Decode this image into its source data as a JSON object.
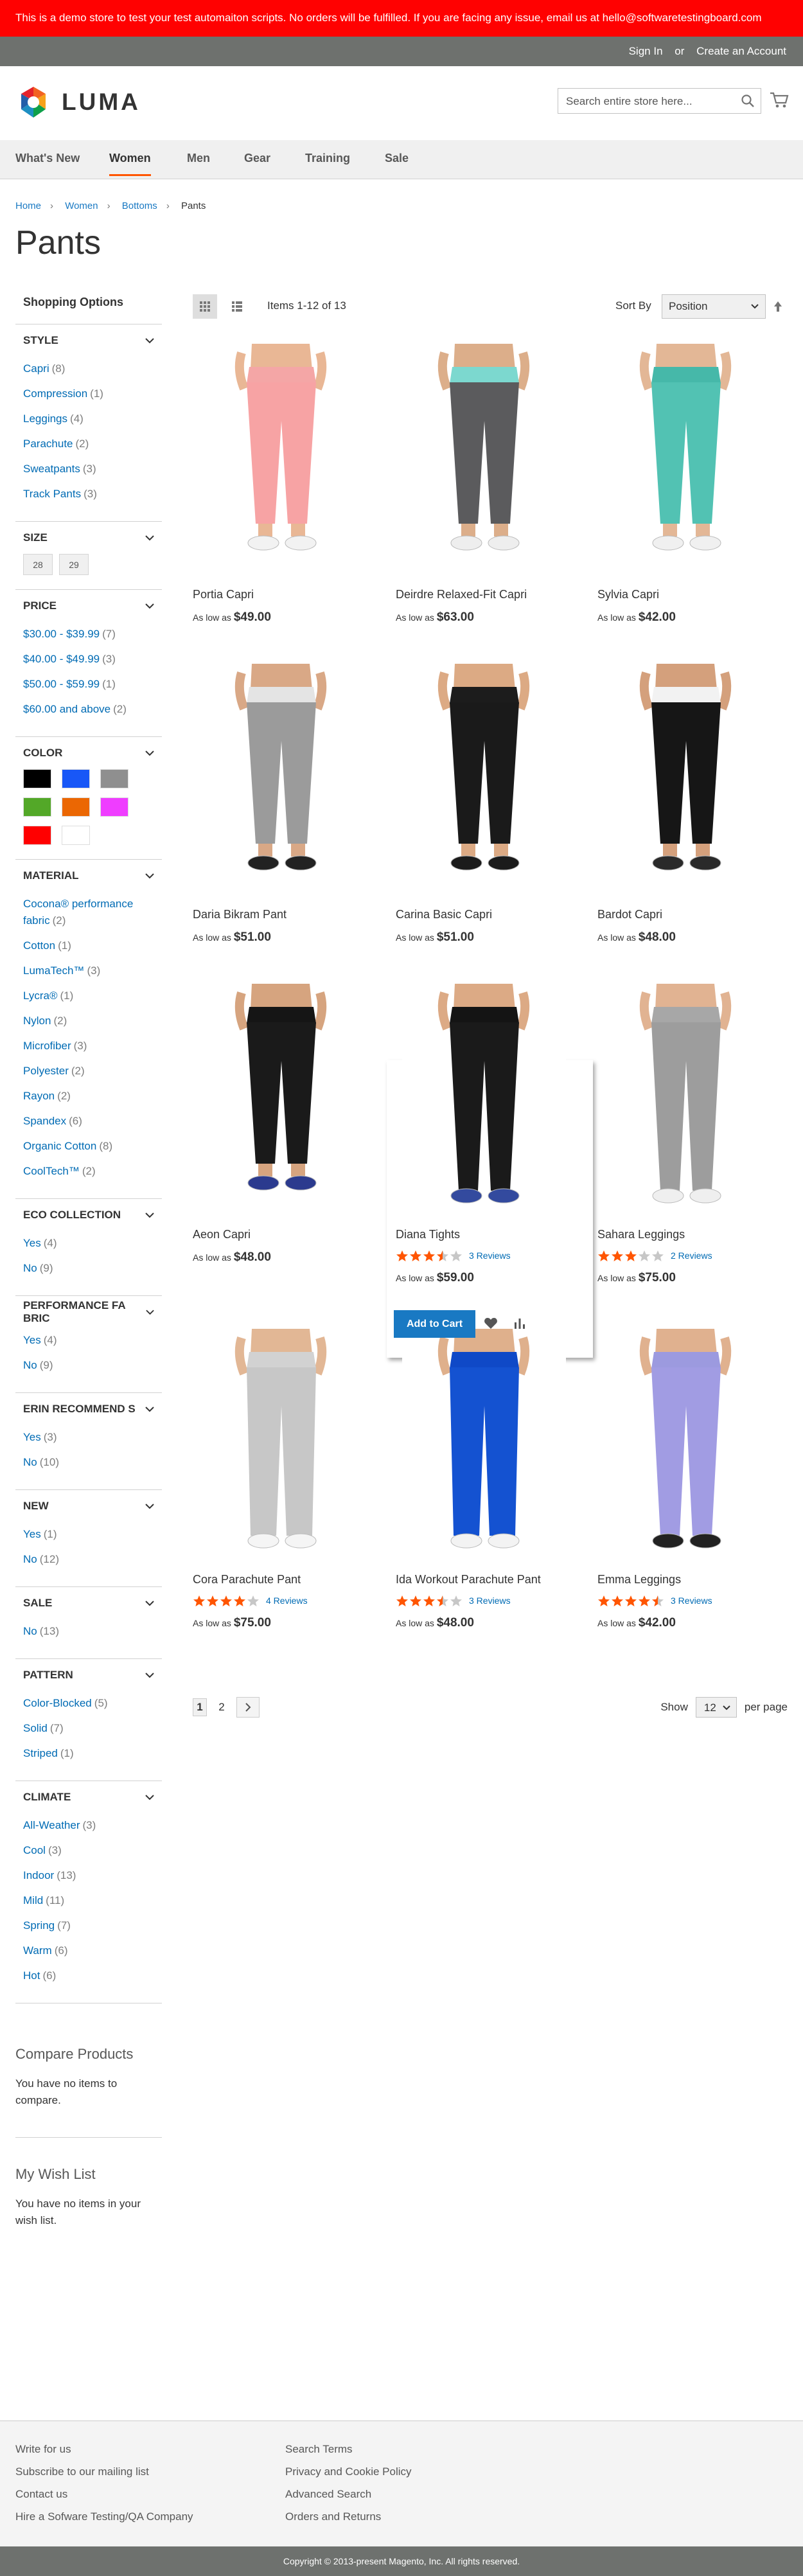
{
  "demo_notice": "This is a demo store to test your test automaiton scripts. No orders will be fulfilled. If you are facing any issue, email us at hello@softwaretestingboard.com",
  "header_links": {
    "sign_in": "Sign In",
    "or": "or",
    "create_account": "Create an Account"
  },
  "logo_text": "LUMA",
  "search": {
    "placeholder": "Search entire store here..."
  },
  "nav": [
    "What's New",
    "Women",
    "Men",
    "Gear",
    "Training",
    "Sale"
  ],
  "breadcrumbs": [
    "Home",
    "Women",
    "Bottoms",
    "Pants"
  ],
  "page_title": "Pants",
  "shopping_options_title": "Shopping Options",
  "filters": {
    "style": {
      "title": "Style",
      "options": [
        {
          "label": "Capri",
          "count": "8"
        },
        {
          "label": "Compression",
          "count": "1"
        },
        {
          "label": "Leggings",
          "count": "4"
        },
        {
          "label": "Parachute",
          "count": "2"
        },
        {
          "label": "Sweatpants",
          "count": "3"
        },
        {
          "label": "Track Pants",
          "count": "3"
        }
      ]
    },
    "size": {
      "title": "Size",
      "options": [
        "28",
        "29"
      ]
    },
    "price": {
      "title": "Price",
      "options": [
        {
          "label": "$30.00 - $39.99",
          "count": "7"
        },
        {
          "label": "$40.00 - $49.99",
          "count": "3"
        },
        {
          "label": "$50.00 - $59.99",
          "count": "1"
        },
        {
          "label": "$60.00 and above",
          "count": "2"
        }
      ]
    },
    "color": {
      "title": "Color",
      "swatches": [
        "#000000",
        "#1857f7",
        "#8f8f8f",
        "#53a828",
        "#eb6703",
        "#ef3dff",
        "#ff0000",
        "#ffffff"
      ]
    },
    "material": {
      "title": "Material",
      "options": [
        {
          "label": "Cocona® performance fabric",
          "count": "2"
        },
        {
          "label": "Cotton",
          "count": "1"
        },
        {
          "label": "LumaTech™",
          "count": "3"
        },
        {
          "label": "Lycra®",
          "count": "1"
        },
        {
          "label": "Nylon",
          "count": "2"
        },
        {
          "label": "Microfiber",
          "count": "3"
        },
        {
          "label": "Polyester",
          "count": "2"
        },
        {
          "label": "Rayon",
          "count": "2"
        },
        {
          "label": "Spandex",
          "count": "6"
        },
        {
          "label": "Organic Cotton",
          "count": "8"
        },
        {
          "label": "CoolTech™",
          "count": "2"
        }
      ]
    },
    "eco": {
      "title": "Eco Collection",
      "options": [
        {
          "label": "Yes",
          "count": "4"
        },
        {
          "label": "No",
          "count": "9"
        }
      ]
    },
    "performance": {
      "title": "Performance Fa bric",
      "options": [
        {
          "label": "Yes",
          "count": "4"
        },
        {
          "label": "No",
          "count": "9"
        }
      ]
    },
    "erin": {
      "title": "Erin Recommend s",
      "options": [
        {
          "label": "Yes",
          "count": "3"
        },
        {
          "label": "No",
          "count": "10"
        }
      ]
    },
    "new": {
      "title": "New",
      "options": [
        {
          "label": "Yes",
          "count": "1"
        },
        {
          "label": "No",
          "count": "12"
        }
      ]
    },
    "sale": {
      "title": "Sale",
      "options": [
        {
          "label": "No",
          "count": "13"
        }
      ]
    },
    "pattern": {
      "title": "Pattern",
      "options": [
        {
          "label": "Color-Blocked",
          "count": "5"
        },
        {
          "label": "Solid",
          "count": "7"
        },
        {
          "label": "Striped",
          "count": "1"
        }
      ]
    },
    "climate": {
      "title": "Climate",
      "options": [
        {
          "label": "All-Weather",
          "count": "3"
        },
        {
          "label": "Cool",
          "count": "3"
        },
        {
          "label": "Indoor",
          "count": "13"
        },
        {
          "label": "Mild",
          "count": "11"
        },
        {
          "label": "Spring",
          "count": "7"
        },
        {
          "label": "Warm",
          "count": "6"
        },
        {
          "label": "Hot",
          "count": "6"
        }
      ]
    }
  },
  "compare": {
    "title": "Compare Products",
    "text": "You have no items to compare."
  },
  "wishlist": {
    "title": "My Wish List",
    "text": "You have no items in your wish list."
  },
  "toolbar": {
    "amount": "Items 1-12 of 13",
    "sort_label": "Sort By",
    "sort_value": "Position"
  },
  "products": [
    {
      "name": "Portia Capri",
      "price_prefix": "As low as",
      "price": "$49.00",
      "colors": {
        "top": "#f4a6a6",
        "leg": "#f7a3a4",
        "skin": "#e9b795",
        "shoe": "#f2f2f2"
      }
    },
    {
      "name": "Deirdre Relaxed-Fit Capri",
      "price_prefix": "As low as",
      "price": "$63.00",
      "colors": {
        "top": "#7cd8cf",
        "leg": "#5b5b5d",
        "skin": "#dcae8a",
        "shoe": "#eeeeee"
      }
    },
    {
      "name": "Sylvia Capri",
      "price_prefix": "As low as",
      "price": "$42.00",
      "colors": {
        "top": "#46b8a9",
        "leg": "#52c2b3",
        "skin": "#e3b796",
        "shoe": "#f0f0f0"
      }
    },
    {
      "name": "Daria Bikram Pant",
      "price_prefix": "As low as",
      "price": "$51.00",
      "colors": {
        "top": "#e4e4e4",
        "leg": "#9b9b9b",
        "skin": "#d9a886",
        "shoe": "#222222"
      }
    },
    {
      "name": "Carina Basic Capri",
      "price_prefix": "As low as",
      "price": "$51.00",
      "colors": {
        "top": "#1c1c1c",
        "leg": "#1a1a1a",
        "skin": "#dcaa84",
        "shoe": "#1b1b1b"
      }
    },
    {
      "name": "Bardot Capri",
      "price_prefix": "As low as",
      "price": "$48.00",
      "colors": {
        "top": "#f2f2f2",
        "leg": "#161616",
        "skin": "#d4a07c",
        "shoe": "#2a2a2a"
      }
    },
    {
      "name": "Aeon Capri",
      "price_prefix": "As low as",
      "price": "$48.00",
      "colors": {
        "top": "#151515",
        "leg": "#1a1a1a",
        "skin": "#d6a47f",
        "shoe": "#2b3a8e"
      }
    },
    {
      "name": "Diana Tights",
      "price_prefix": "As low as",
      "price": "$59.00",
      "rating": 3.5,
      "reviews": "3 Reviews",
      "colors": {
        "top": "#141414",
        "leg": "#1a1a1a",
        "skin": "#dcaa85",
        "shoe": "#334a9e"
      }
    },
    {
      "name": "Sahara Leggings",
      "price_prefix": "As low as",
      "price": "$75.00",
      "rating": 3,
      "reviews": "2 Reviews",
      "colors": {
        "top": "#a7a7a7",
        "leg": "#9d9d9d",
        "skin": "#e1b392",
        "shoe": "#efefef"
      }
    },
    {
      "name": "Cora Parachute Pant",
      "price_prefix": "As low as",
      "price": "$75.00",
      "rating": 4,
      "reviews": "4 Reviews",
      "colors": {
        "top": "#d2d2d2",
        "leg": "#c7c7c7",
        "skin": "#e2b795",
        "shoe": "#f5f5f5"
      }
    },
    {
      "name": "Ida Workout Parachute Pant",
      "price_prefix": "As low as",
      "price": "$48.00",
      "rating": 3.5,
      "reviews": "3 Reviews",
      "colors": {
        "top": "#0f49c7",
        "leg": "#1452d1",
        "skin": "#dfb08c",
        "shoe": "#f3f3f3"
      }
    },
    {
      "name": "Emma Leggings",
      "price_prefix": "As low as",
      "price": "$42.00",
      "rating": 4.5,
      "reviews": "3 Reviews",
      "colors": {
        "top": "#9c9adf",
        "leg": "#a19ce3",
        "skin": "#e0b18f",
        "shoe": "#222222"
      }
    }
  ],
  "add_to_cart": "Add to Cart",
  "pager": {
    "pages": [
      "1",
      "2"
    ],
    "show_label": "Show",
    "limit": "12",
    "per_page": "per page"
  },
  "footer": {
    "col1": [
      "Write for us",
      "Subscribe to our mailing list",
      "Contact us",
      "Hire a Sofware Testing/QA Company"
    ],
    "col2": [
      "Search Terms",
      "Privacy and Cookie Policy",
      "Advanced Search",
      "Orders and Returns"
    ]
  },
  "copyright": "Copyright © 2013-present Magento, Inc. All rights reserved.",
  "colors": {
    "accent": "#1979c3",
    "star": "#ff5501",
    "demo_bar": "#ff0101",
    "footer_bar": "#6e716e"
  }
}
